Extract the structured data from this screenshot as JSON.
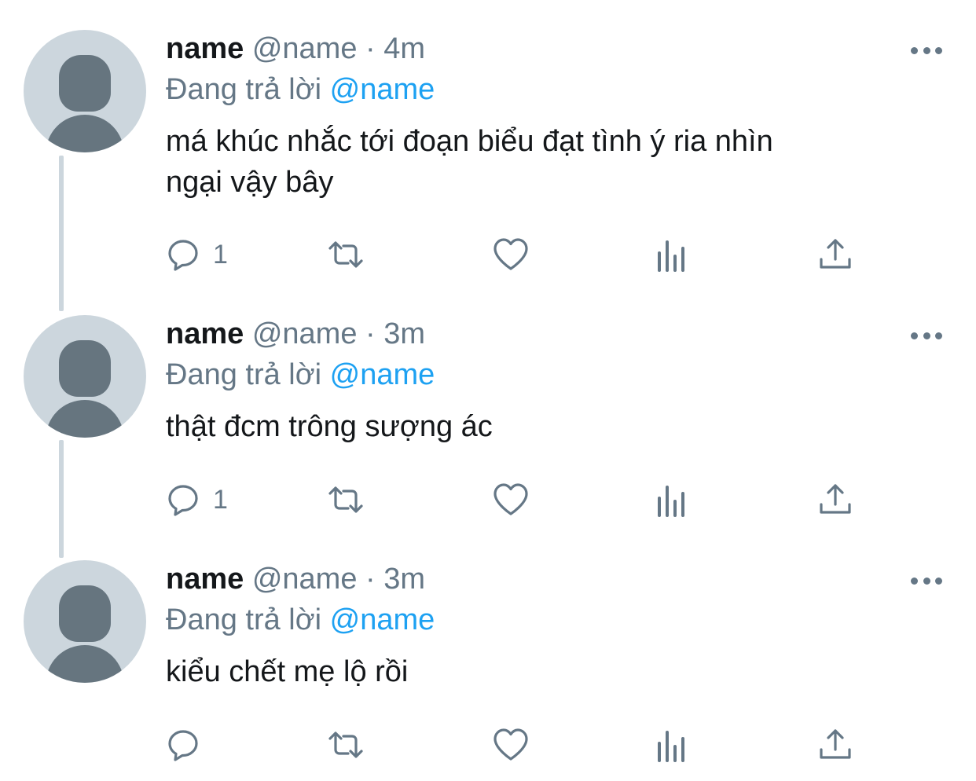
{
  "colors": {
    "text_primary": "#14171a",
    "text_secondary": "#657786",
    "mention": "#1da1f2",
    "avatar_bg": "#ccd6dd",
    "avatar_fg": "#66757f",
    "thread_line": "#ccd6dd"
  },
  "icons": {
    "reply": "reply-icon",
    "retweet": "retweet-icon",
    "like": "heart-icon",
    "analytics": "analytics-icon",
    "share": "share-icon",
    "more": "more-icon",
    "avatar": "default-avatar-icon"
  },
  "tweets": [
    {
      "display_name": "name",
      "handle": "@name",
      "separator": "·",
      "time": "4m",
      "reply_prefix": "Đang trả lời",
      "reply_to": "@name",
      "text": "má khúc nhắc tới đoạn biểu đạt tình ý ria nhìn\nngại vậy bây",
      "reply_count": "1"
    },
    {
      "display_name": "name",
      "handle": "@name",
      "separator": "·",
      "time": "3m",
      "reply_prefix": "Đang trả lời",
      "reply_to": "@name",
      "text": "thật đcm trông sượng ác",
      "reply_count": "1"
    },
    {
      "display_name": "name",
      "handle": "@name",
      "separator": "·",
      "time": "3m",
      "reply_prefix": "Đang trả lời",
      "reply_to": "@name",
      "text": "kiểu chết mẹ lộ rồi",
      "reply_count": ""
    }
  ]
}
